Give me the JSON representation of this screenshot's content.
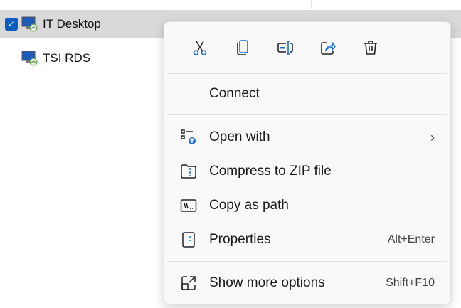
{
  "list": {
    "items": [
      {
        "label": "IT Desktop",
        "selected": true
      },
      {
        "label": "TSI RDS",
        "selected": false
      }
    ],
    "checkmark": "✓"
  },
  "menu": {
    "toolbar": [
      {
        "name": "cut-icon"
      },
      {
        "name": "copy-icon"
      },
      {
        "name": "rename-icon"
      },
      {
        "name": "share-icon"
      },
      {
        "name": "delete-icon"
      }
    ],
    "connect": "Connect",
    "open_with": "Open with",
    "open_with_arrow": "›",
    "compress": "Compress to ZIP file",
    "copy_path": "Copy as path",
    "properties": "Properties",
    "properties_key": "Alt+Enter",
    "more": "Show more options",
    "more_key": "Shift+F10"
  },
  "colors": {
    "accent": "#0a5dc2",
    "selection": "#d9d9d9"
  }
}
